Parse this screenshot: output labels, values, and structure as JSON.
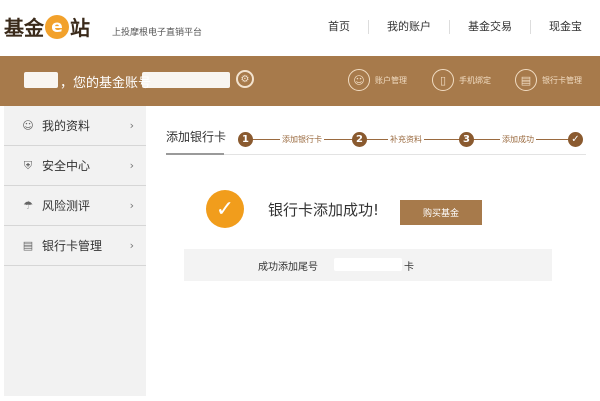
{
  "header": {
    "logo": {
      "part1": "基金",
      "e_mark": "e",
      "part2": "站"
    },
    "tagline": "上投摩根电子直销平台",
    "nav": [
      "首页",
      "我的账户",
      "基金交易",
      "现金宝"
    ]
  },
  "banner": {
    "greeting": "，您的基金账号",
    "quick_links": [
      {
        "label": "账户管理",
        "icon": "user-icon"
      },
      {
        "label": "手机绑定",
        "icon": "phone-icon"
      },
      {
        "label": "银行卡管理",
        "icon": "card-icon"
      }
    ]
  },
  "sidebar": {
    "items": [
      {
        "label": "我的资料",
        "icon": "user-icon"
      },
      {
        "label": "安全中心",
        "icon": "shield-icon"
      },
      {
        "label": "风险测评",
        "icon": "umbrella-icon"
      },
      {
        "label": "银行卡管理",
        "icon": "card-icon"
      }
    ]
  },
  "main": {
    "tab_title": "添加银行卡",
    "steps": [
      {
        "num": "1",
        "label": "添加银行卡"
      },
      {
        "num": "2",
        "label": "补充资料"
      },
      {
        "num": "3",
        "label": "添加成功"
      },
      {
        "num": "✓",
        "label": ""
      }
    ],
    "success_message": "银行卡添加成功!",
    "buy_button": "购买基金",
    "info_prefix": "成功添加尾号",
    "info_suffix": "卡"
  },
  "colors": {
    "brand_brown": "#a77a4b",
    "step_brown": "#8a5a2f",
    "success_orange": "#f19d1c",
    "sidebar_bg": "#f2f2f2"
  }
}
